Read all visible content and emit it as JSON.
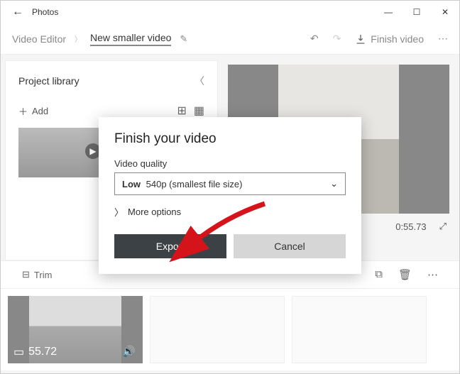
{
  "window": {
    "title": "Photos"
  },
  "header": {
    "crumb_root": "Video Editor",
    "crumb_current": "New smaller video",
    "finish_label": "Finish video"
  },
  "library": {
    "title": "Project library",
    "add_label": "Add"
  },
  "preview": {
    "duration": "0:55.73"
  },
  "strip": {
    "trim_label": "Trim",
    "clip_duration": "55.72"
  },
  "dialog": {
    "title": "Finish your video",
    "quality_label": "Video quality",
    "quality_bold": "Low",
    "quality_rest": "540p (smallest file size)",
    "more_label": "More options",
    "export_label": "Export",
    "cancel_label": "Cancel"
  }
}
